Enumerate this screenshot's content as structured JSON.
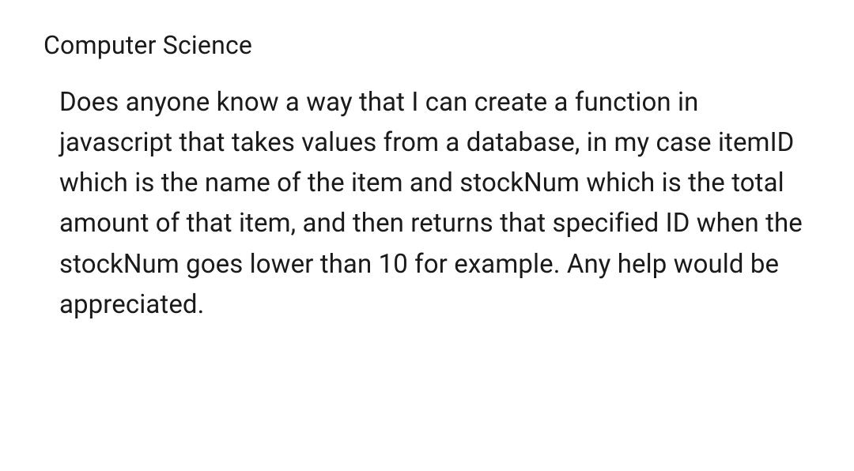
{
  "heading": "Computer Science",
  "body": "Does anyone know a way that I can create a function in javascript that takes values from a database, in my case itemID which is the name of the item and stockNum which is the total amount of that item, and then returns that specified ID when the stockNum goes lower than 10 for example. Any help would be appreciated."
}
